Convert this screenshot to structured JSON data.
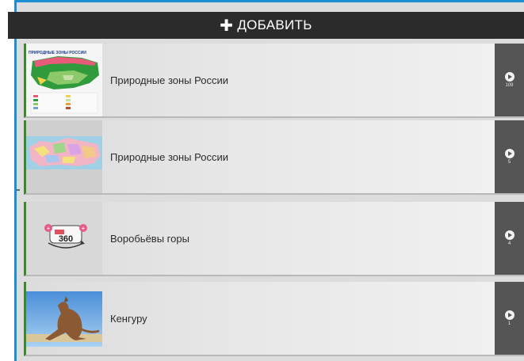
{
  "add_button": {
    "icon": "plus-icon",
    "label": "ДОБАВИТЬ"
  },
  "items": [
    {
      "title": "Природные зоны России",
      "count": "109",
      "thumbnail": "map-thumbnail-icon",
      "map_title": "ПРИРОДНЫЕ ЗОНЫ РОССИИ"
    },
    {
      "title": "Природные зоны России",
      "count": "5",
      "thumbnail": "political-map-thumbnail-icon"
    },
    {
      "title": "Воробьёвы горы",
      "count": "4",
      "thumbnail": "panorama-360-icon",
      "badge": "360"
    },
    {
      "title": "Кенгуру",
      "count": "1",
      "thumbnail": "kangaroo-thumbnail-icon"
    }
  ],
  "colors": {
    "frame": "#1b8fd2",
    "item_stripe": "#3a8a2a",
    "header": "#2b2b2b"
  }
}
